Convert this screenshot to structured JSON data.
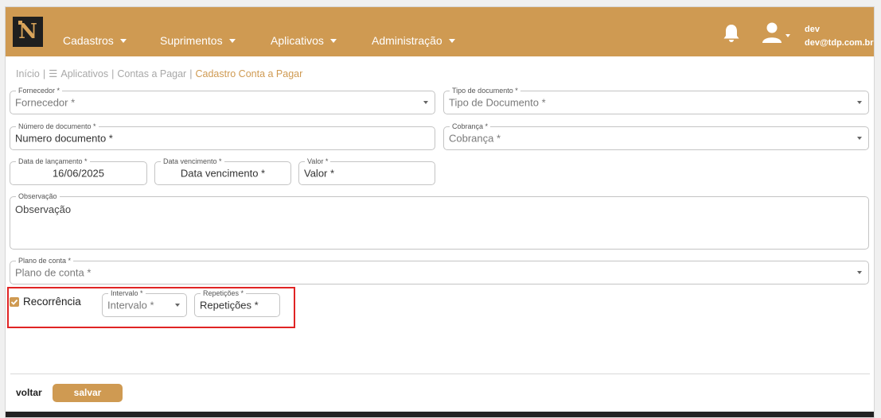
{
  "navbar": {
    "logo_text": "N",
    "menu": [
      {
        "label": "Cadastros"
      },
      {
        "label": "Suprimentos"
      },
      {
        "label": "Aplicativos"
      },
      {
        "label": "Administração"
      }
    ],
    "user_name": "dev",
    "user_email": "dev@tdp.com.br",
    "bell_icon": "bell-icon",
    "user_icon": "user-icon"
  },
  "breadcrumb": {
    "inicio": "Início",
    "aplicativos": "Aplicativos",
    "contas": "Contas a Pagar",
    "current": "Cadastro Conta a Pagar",
    "separator": "|",
    "menu_glyph": "☰"
  },
  "form": {
    "fornecedor": {
      "label": "Fornecedor *",
      "placeholder": "Fornecedor *"
    },
    "tipo_documento": {
      "label": "Tipo de documento *",
      "placeholder": "Tipo de Documento *"
    },
    "numero_documento": {
      "label": "Número de documento *",
      "placeholder": "Numero documento *"
    },
    "cobranca": {
      "label": "Cobrança *",
      "placeholder": "Cobrança *"
    },
    "data_lancamento": {
      "label": "Data de lançamento *",
      "value": "16/06/2025"
    },
    "data_vencimento": {
      "label": "Data vencimento *",
      "placeholder": "Data vencimento *"
    },
    "valor": {
      "label": "Valor *",
      "placeholder": "Valor *"
    },
    "observacao": {
      "label": "Observação",
      "placeholder": "Observação"
    },
    "plano_conta": {
      "label": "Plano de conta *",
      "placeholder": "Plano de conta *"
    },
    "recorrencia": {
      "label": "Recorrência",
      "checked": true
    },
    "intervalo": {
      "label": "Intervalo *",
      "placeholder": "Intervalo *"
    },
    "repeticoes": {
      "label": "Repetições *",
      "placeholder": "Repetições *"
    }
  },
  "actions": {
    "voltar": "voltar",
    "salvar": "salvar"
  },
  "colors": {
    "accent": "#cf9a52",
    "highlight": "#e02424"
  }
}
